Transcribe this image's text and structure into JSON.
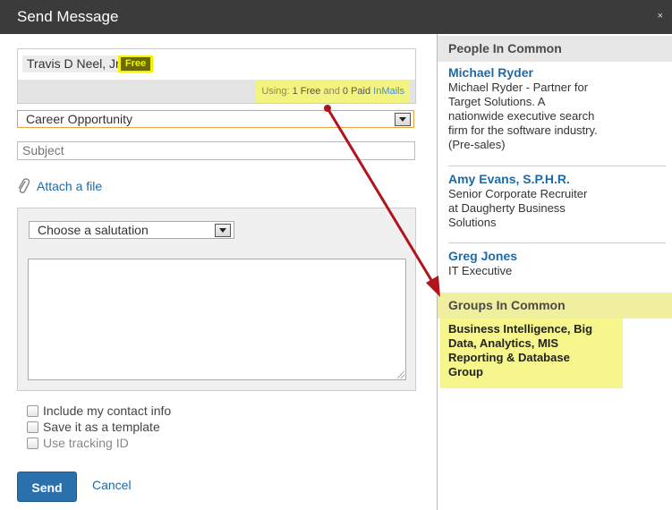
{
  "dialog": {
    "title": "Send Message",
    "close_symbol": "×"
  },
  "recipient": {
    "name": "Travis D Neel, Jr",
    "badge": "Free",
    "usage_prefix": "Using:",
    "usage_free": "1 Free",
    "usage_and": "and",
    "usage_paid": "0 Paid",
    "usage_suffix": "InMails"
  },
  "category_select": {
    "value": "Career Opportunity"
  },
  "subject": {
    "placeholder": "Subject",
    "value": ""
  },
  "attach": {
    "label": "Attach a file",
    "icon": "paperclip-icon"
  },
  "salutation_select": {
    "value": "Choose a salutation"
  },
  "message_body": {
    "value": ""
  },
  "options": [
    {
      "label": "Include my contact info",
      "checked": false,
      "disabled": false
    },
    {
      "label": "Save it as a template",
      "checked": false,
      "disabled": false
    },
    {
      "label": "Use tracking ID",
      "checked": false,
      "disabled": true
    }
  ],
  "actions": {
    "send": "Send",
    "cancel": "Cancel"
  },
  "sidebar": {
    "people_heading": "People In Common",
    "people": [
      {
        "name": "Michael Ryder",
        "lines": [
          "Michael Ryder - Partner for",
          "Target Solutions. A",
          "nationwide executive search",
          "firm for the software industry.",
          "(Pre-sales)"
        ]
      },
      {
        "name": "Amy Evans, S.P.H.R.",
        "lines": [
          "Senior Corporate Recruiter",
          "at Daugherty Business",
          "Solutions"
        ]
      },
      {
        "name": "Greg Jones",
        "lines": [
          "IT Executive"
        ]
      }
    ],
    "groups_heading": "Groups In Common",
    "groups": [
      {
        "lines": [
          "Business Intelligence, Big",
          "Data, Analytics, MIS",
          "Reporting & Database",
          "Group"
        ]
      }
    ]
  },
  "colors": {
    "highlight": "#f6f68c",
    "arrow": "#b0141c",
    "link": "#1f6aa5",
    "send_button": "#2a70ad"
  }
}
